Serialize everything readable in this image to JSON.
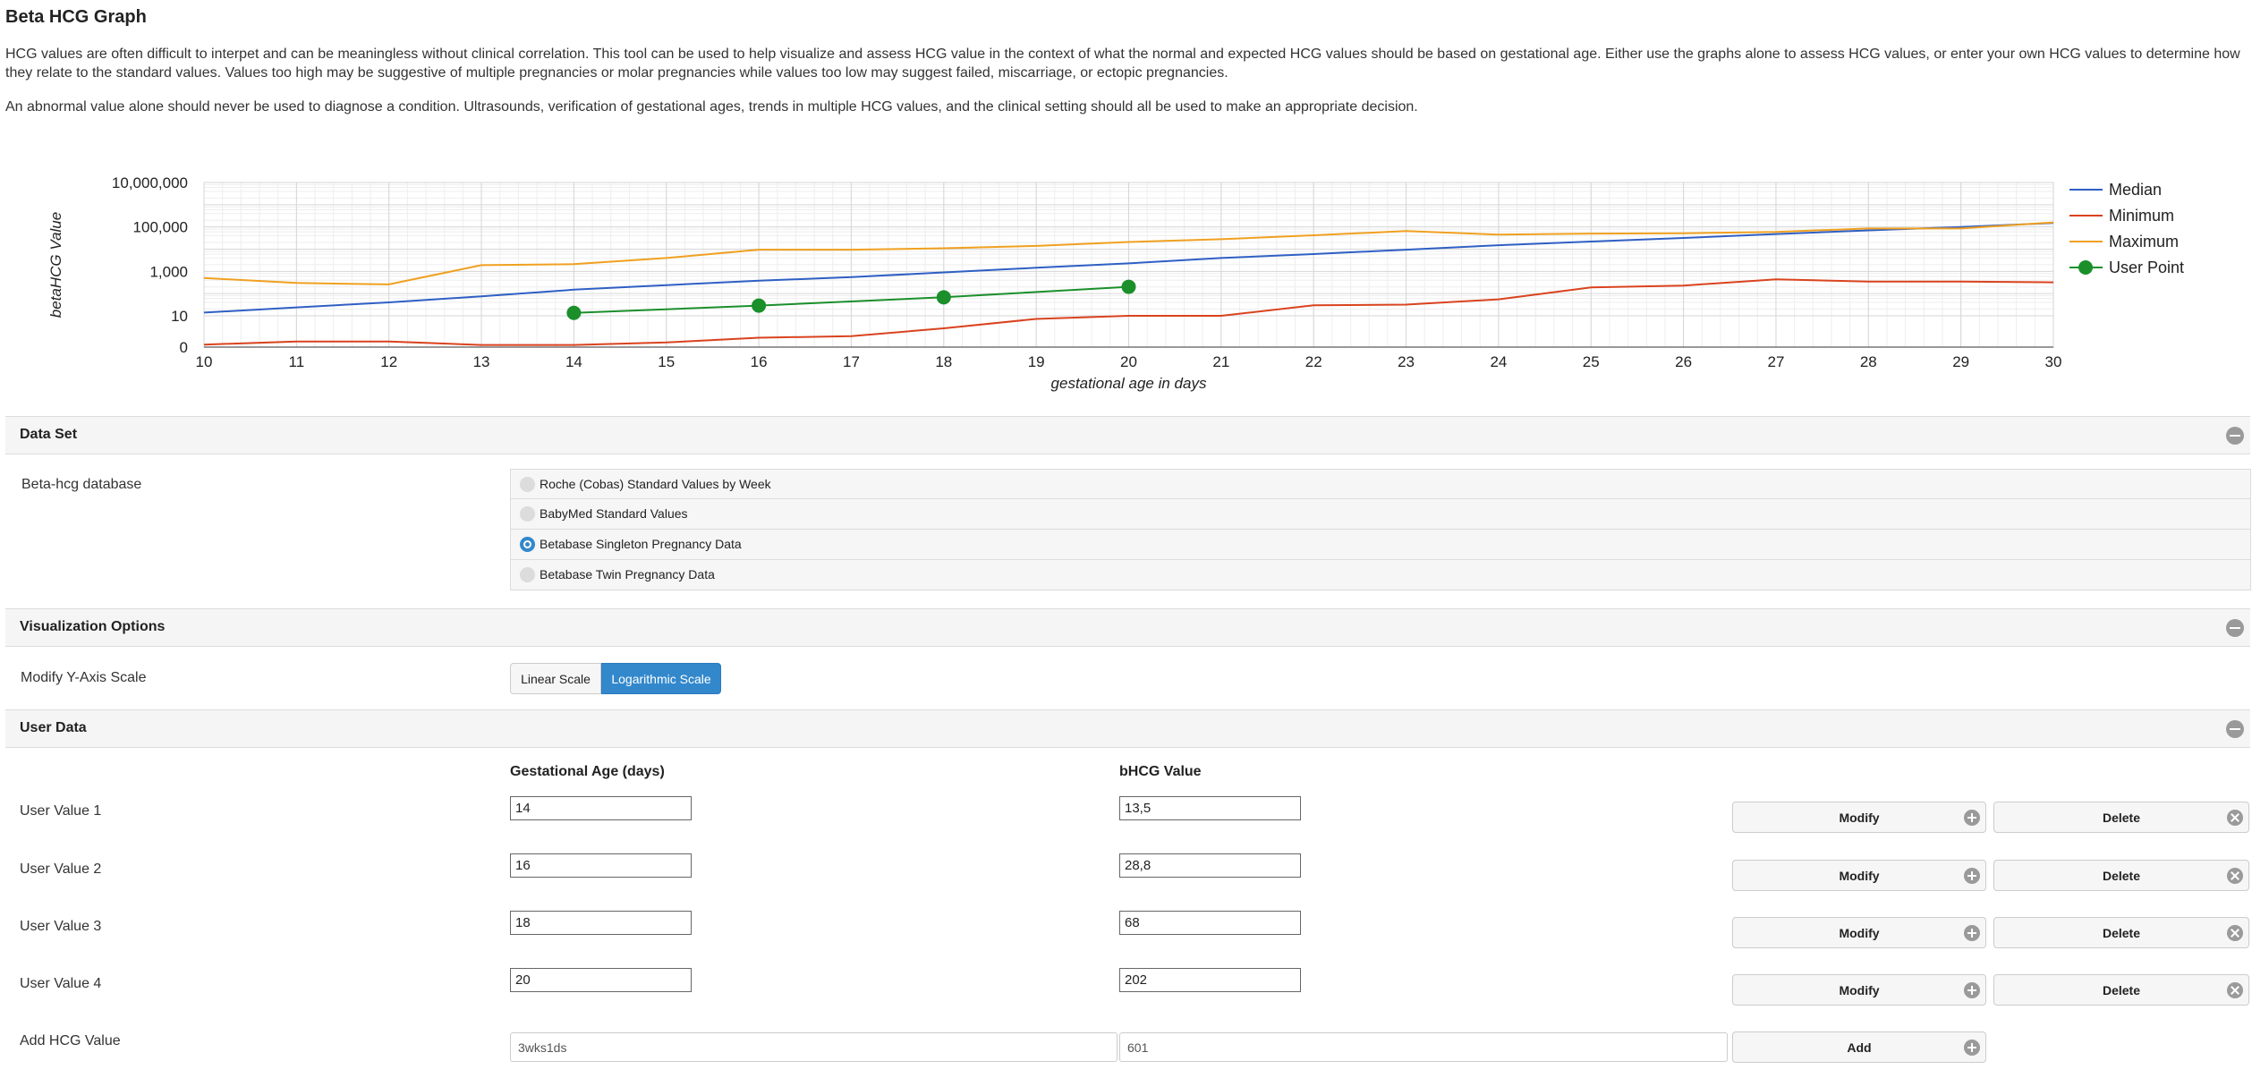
{
  "page": {
    "title": "Beta HCG Graph",
    "intro_1": "HCG values are often difficult to interpet and can be meaningless without clinical correlation. This tool can be used to help visualize and assess HCG value in the context of what the normal and expected HCG values should be based on gestational age. Either use the graphs alone to assess HCG values, or enter your own HCG values to determine how they relate to the standard values. Values too high may be suggestive of multiple pregnancies or molar pregnancies while values too low may suggest failed, miscarriage, or ectopic pregnancies.",
    "intro_2": "An abnormal value alone should never be used to diagnose a condition. Ultrasounds, verification of gestational ages, trends in multiple HCG values, and the clinical setting should all be used to make an appropriate decision."
  },
  "chart_data": {
    "type": "line",
    "xlabel": "gestational age in days",
    "ylabel": "betaHCG Value",
    "x_ticks": [
      10,
      11,
      12,
      13,
      14,
      15,
      16,
      17,
      18,
      19,
      20,
      21,
      22,
      23,
      24,
      25,
      26,
      27,
      28,
      29,
      30
    ],
    "y_ticks": [
      0,
      10,
      1000,
      100000,
      10000000
    ],
    "y_tick_labels": [
      "0",
      "10",
      "1,000",
      "100,000",
      "10,000,000"
    ],
    "y_scale": "log",
    "xlim": [
      10,
      30
    ],
    "grid": true,
    "legend_position": "right",
    "series": [
      {
        "name": "Median",
        "color": "#2f5fc4",
        "x": [
          10,
          11,
          12,
          13,
          14,
          15,
          16,
          17,
          18,
          19,
          20,
          21,
          22,
          23,
          24,
          25,
          26,
          27,
          28,
          29,
          30
        ],
        "y": [
          14,
          24,
          40,
          75,
          150,
          240,
          380,
          550,
          900,
          1450,
          2300,
          4000,
          6000,
          9500,
          15000,
          22000,
          32000,
          48000,
          70000,
          100000,
          150000
        ]
      },
      {
        "name": "Minimum",
        "color": "#d9431e",
        "x": [
          10,
          11,
          12,
          13,
          14,
          15,
          16,
          17,
          18,
          19,
          20,
          21,
          22,
          23,
          24,
          25,
          26,
          27,
          28,
          29,
          30
        ],
        "y": [
          0.8,
          1.8,
          1.8,
          0.7,
          0.7,
          1.5,
          3,
          3.5,
          6,
          9,
          10,
          10,
          30,
          32,
          55,
          190,
          230,
          440,
          350,
          350,
          320
        ]
      },
      {
        "name": "Maximum",
        "color": "#f0a020",
        "x": [
          10,
          11,
          12,
          13,
          14,
          15,
          16,
          17,
          18,
          19,
          20,
          21,
          22,
          23,
          24,
          25,
          26,
          27,
          28,
          29,
          30
        ],
        "y": [
          500,
          300,
          260,
          1900,
          2100,
          4000,
          9500,
          9500,
          11000,
          14000,
          21000,
          28000,
          42000,
          65000,
          45000,
          50000,
          52000,
          60000,
          85000,
          85000,
          160000
        ]
      },
      {
        "name": "User Point",
        "color": "#1a8f2a",
        "marker": "circle",
        "x": [
          14,
          16,
          18,
          20
        ],
        "y": [
          13.5,
          28.8,
          68,
          202
        ]
      }
    ]
  },
  "data_set": {
    "header": "Data Set",
    "label": "Beta-hcg database",
    "options": [
      {
        "label": "Roche (Cobas) Standard Values by Week",
        "selected": false
      },
      {
        "label": "BabyMed Standard Values",
        "selected": false
      },
      {
        "label": "Betabase Singleton Pregnancy Data",
        "selected": true
      },
      {
        "label": "Betabase Twin Pregnancy Data",
        "selected": false
      }
    ]
  },
  "visualization": {
    "header": "Visualization Options",
    "label": "Modify Y-Axis Scale",
    "linear_label": "Linear Scale",
    "log_label": "Logarithmic Scale",
    "active": "log"
  },
  "user_data": {
    "header": "User Data",
    "col_age": "Gestational Age (days)",
    "col_value": "bHCG Value",
    "modify_label": "Modify",
    "delete_label": "Delete",
    "rows": [
      {
        "label": "User Value 1",
        "age": "14",
        "value": "13,5"
      },
      {
        "label": "User Value 2",
        "age": "16",
        "value": "28,8"
      },
      {
        "label": "User Value 3",
        "age": "18",
        "value": "68"
      },
      {
        "label": "User Value 4",
        "age": "20",
        "value": "202"
      }
    ],
    "add": {
      "label": "Add HCG Value",
      "age": "3wks1ds",
      "value": "601",
      "button": "Add"
    }
  }
}
